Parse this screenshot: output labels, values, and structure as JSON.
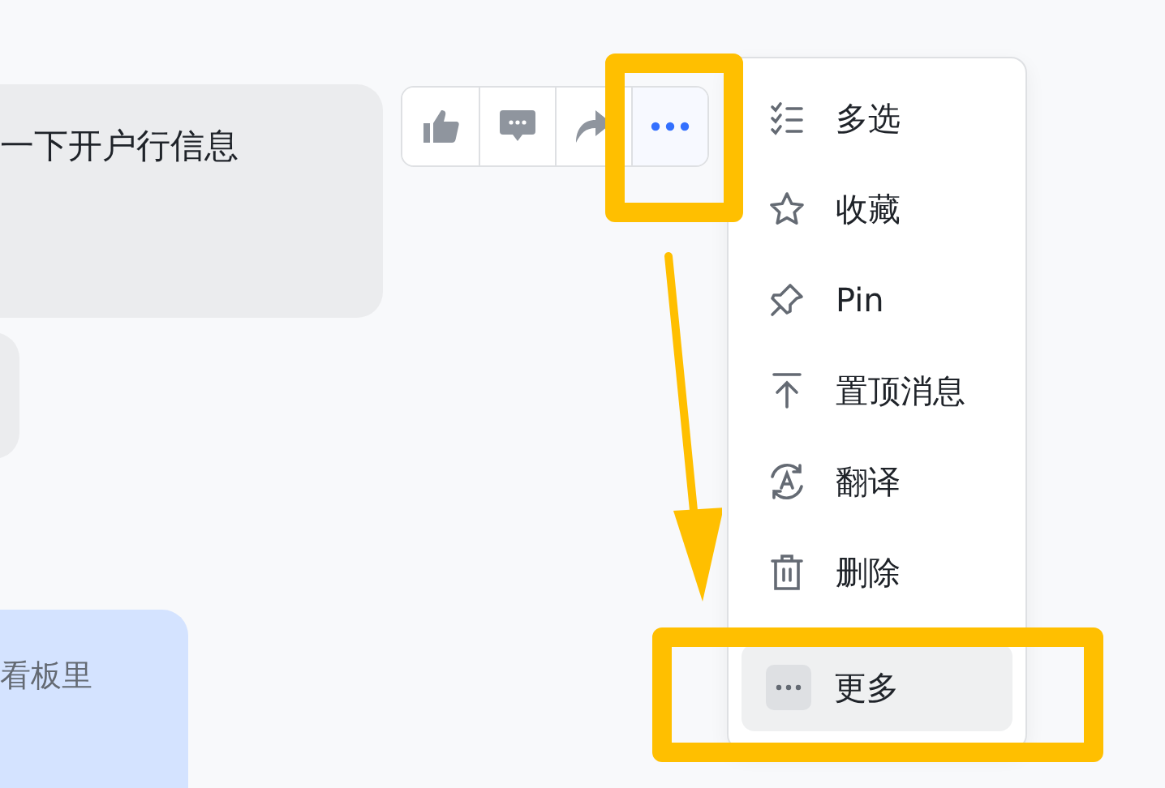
{
  "messages": [
    {
      "kind": "received",
      "text": "一下开户行信息"
    },
    {
      "kind": "received"
    },
    {
      "kind": "sent",
      "text": "看板里"
    }
  ],
  "actions": [
    {
      "kind": "like",
      "selected": false
    },
    {
      "kind": "comment",
      "selected": false
    },
    {
      "kind": "forward",
      "selected": false
    },
    {
      "kind": "more",
      "selected": true
    }
  ],
  "menu": {
    "items": [
      {
        "kind": "multiselect",
        "label": "多选",
        "selected": false
      },
      {
        "kind": "star",
        "label": "收藏",
        "selected": false
      },
      {
        "kind": "pin",
        "label": "Pin",
        "selected": false
      },
      {
        "kind": "top",
        "label": "置顶消息",
        "selected": false
      },
      {
        "kind": "translate",
        "label": "翻译",
        "selected": false
      },
      {
        "kind": "delete",
        "label": "删除",
        "selected": false
      },
      {
        "kind": "more",
        "label": "更多",
        "selected": true
      }
    ]
  },
  "annotations": [
    {
      "kind": "box"
    },
    {
      "kind": "box"
    },
    {
      "kind": "arrow"
    }
  ]
}
